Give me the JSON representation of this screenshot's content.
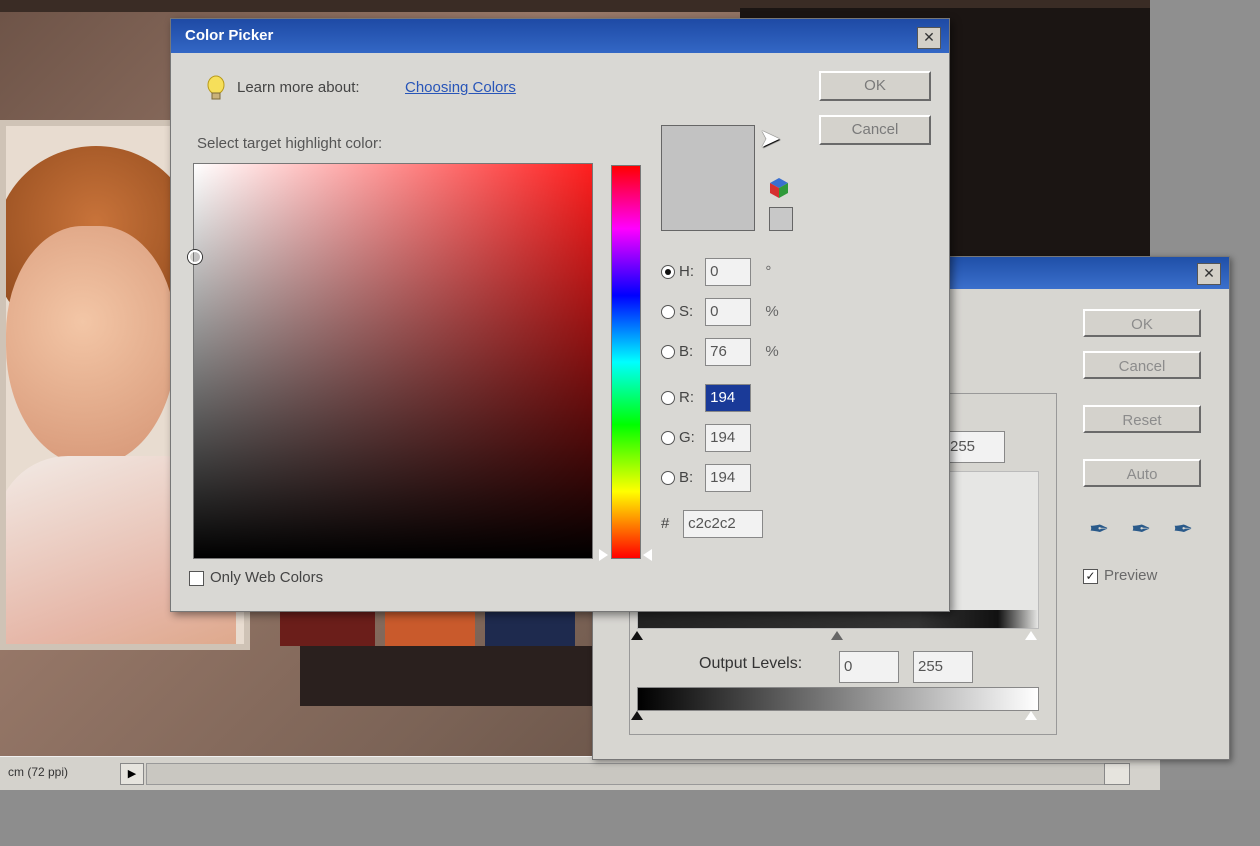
{
  "status_bar": {
    "zoom_text": "cm (72 ppi)"
  },
  "levels": {
    "buttons": {
      "ok": "OK",
      "cancel": "Cancel",
      "reset": "Reset",
      "auto": "Auto"
    },
    "input_white": "255",
    "output_label": "Output Levels:",
    "output_black": "0",
    "output_white": "255",
    "preview_label": "Preview",
    "preview_checked": true
  },
  "color_picker": {
    "title": "Color Picker",
    "learn_more": "Learn more about:",
    "learn_link": "Choosing Colors",
    "target_label": "Select target highlight color:",
    "buttons": {
      "ok": "OK",
      "cancel": "Cancel"
    },
    "fields": {
      "h": {
        "label": "H:",
        "value": "0",
        "unit": "°",
        "selected": true
      },
      "s": {
        "label": "S:",
        "value": "0",
        "unit": "%"
      },
      "bri": {
        "label": "B:",
        "value": "76",
        "unit": "%"
      },
      "r": {
        "label": "R:",
        "value": "194"
      },
      "g": {
        "label": "G:",
        "value": "194"
      },
      "b": {
        "label": "B:",
        "value": "194"
      }
    },
    "hex_label": "#",
    "hex_value": "c2c2c2",
    "web_only_label": "Only Web Colors",
    "current_color": "#c2c2c2"
  }
}
